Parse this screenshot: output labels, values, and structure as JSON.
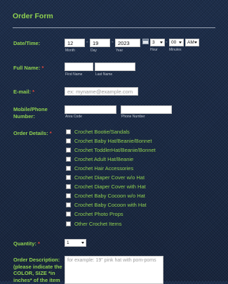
{
  "form": {
    "title": "Order Form"
  },
  "datetime": {
    "label": "Date/Time:",
    "month": "12",
    "day": "19",
    "year": "2023",
    "month_label": "Month",
    "day_label": "Day",
    "year_label": "Year",
    "separator": "-",
    "hour": "3",
    "minute": "00",
    "ampm": "AM",
    "hour_label": "Hour",
    "minutes_label": "Minutes"
  },
  "fullname": {
    "label": "Full Name:",
    "required": "*",
    "first_label": "First Name",
    "last_label": "Last Name"
  },
  "email": {
    "label": "E-mail:",
    "required": "*",
    "placeholder": "ex: myname@example.com"
  },
  "phone": {
    "label": "Mobile/Phone Number:",
    "area_label": "Area Code",
    "phone_label": "Phone Number"
  },
  "order_details": {
    "label": "Order Details:",
    "required": "*",
    "items": [
      "Crochet Bootie/Sandals",
      "Crochet Baby Hat/Beanie/Bonnet",
      "Crochet ToddlerHat/Beanie/Bonnet",
      "Crochet Adult Hat/Beanie",
      "Crochet Hair Accessories",
      "Crochet Diaper Cover w/o Hat",
      "Crochet Diaper Cover with Hat",
      "Crochet Baby Cocoon w/o Hat",
      "Crochet Baby Cocoon with Hat",
      "Crochet Photo Props",
      "Other Crochet Items"
    ]
  },
  "quantity": {
    "label": "Quantity:",
    "required": "*",
    "value": "1"
  },
  "description": {
    "label_line1": "Order Description:",
    "label_line2": "(please indicate the",
    "label_line3": "COLOR, SIZE *in",
    "label_line4": "inches* of the item",
    "placeholder": "for example: 19\" pink hat with pom-poms"
  },
  "colors": {
    "accent": "#8fd14f",
    "required": "#e4473b",
    "background": "#1b2a44"
  }
}
